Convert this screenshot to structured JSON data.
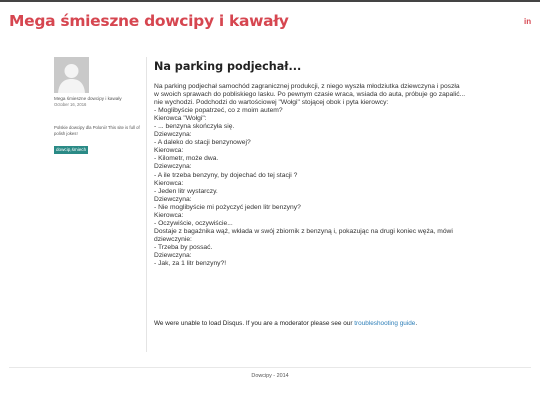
{
  "site": {
    "title": "Mega śmieszne dowcipy i kawały",
    "social": "in"
  },
  "author": {
    "name": "Mega śmieszne dowcipy i kawały",
    "date": "October 16, 2016",
    "bio": "Polskie dowcipy dla Polonii! This site is full of polish jokes!",
    "tag": "dowcip,śmiech"
  },
  "post": {
    "title": "Na parking podjechał...",
    "lines": [
      "Na parking podjechał samochód zagranicznej produkcji, z niego wyszła młodziutka dziewczyna i poszła",
      "w swoich sprawach do pobliskiego lasku. Po pewnym czasie wraca, wsiada do auta, próbuje go zapalić...",
      "nie wychodzi. Podchodzi do wartościowej \"Wołgi\" stojącej obok i pyta kierowcy:",
      "- Moglibyście popatrzeć, co z moim autem?",
      "Kierowca \"Wołgi\":",
      "- ... benzyna skończyła się.",
      "Dziewczyna:",
      "- A daleko do stacji benzynowej?",
      "Kierowca:",
      "- Kilometr, może dwa.",
      "Dziewczyna:",
      "- A ile trzeba benzyny, by dojechać do tej stacji ?",
      "Kierowca:",
      "- Jeden litr wystarczy.",
      "Dziewczyna:",
      "- Nie moglibyście mi pożyczyć jeden litr benzyny?",
      "Kierowca:",
      "- Oczywiście, oczywiście...",
      "Dostaje z bagażnika wąż, wkłada w swój zbiornik z benzyną i, pokazując na drugi koniec węża, mówi",
      "dziewczynie:",
      "- Trzeba by possać.",
      "Dziewczyna:",
      "- Jak, za 1 litr benzyny?!"
    ]
  },
  "disqus": {
    "message": "We were unable to load Disqus. If you are a moderator please see our ",
    "link": "troubleshooting guide",
    "end": "."
  },
  "footer": {
    "text": "Dowcipy - 2014"
  }
}
